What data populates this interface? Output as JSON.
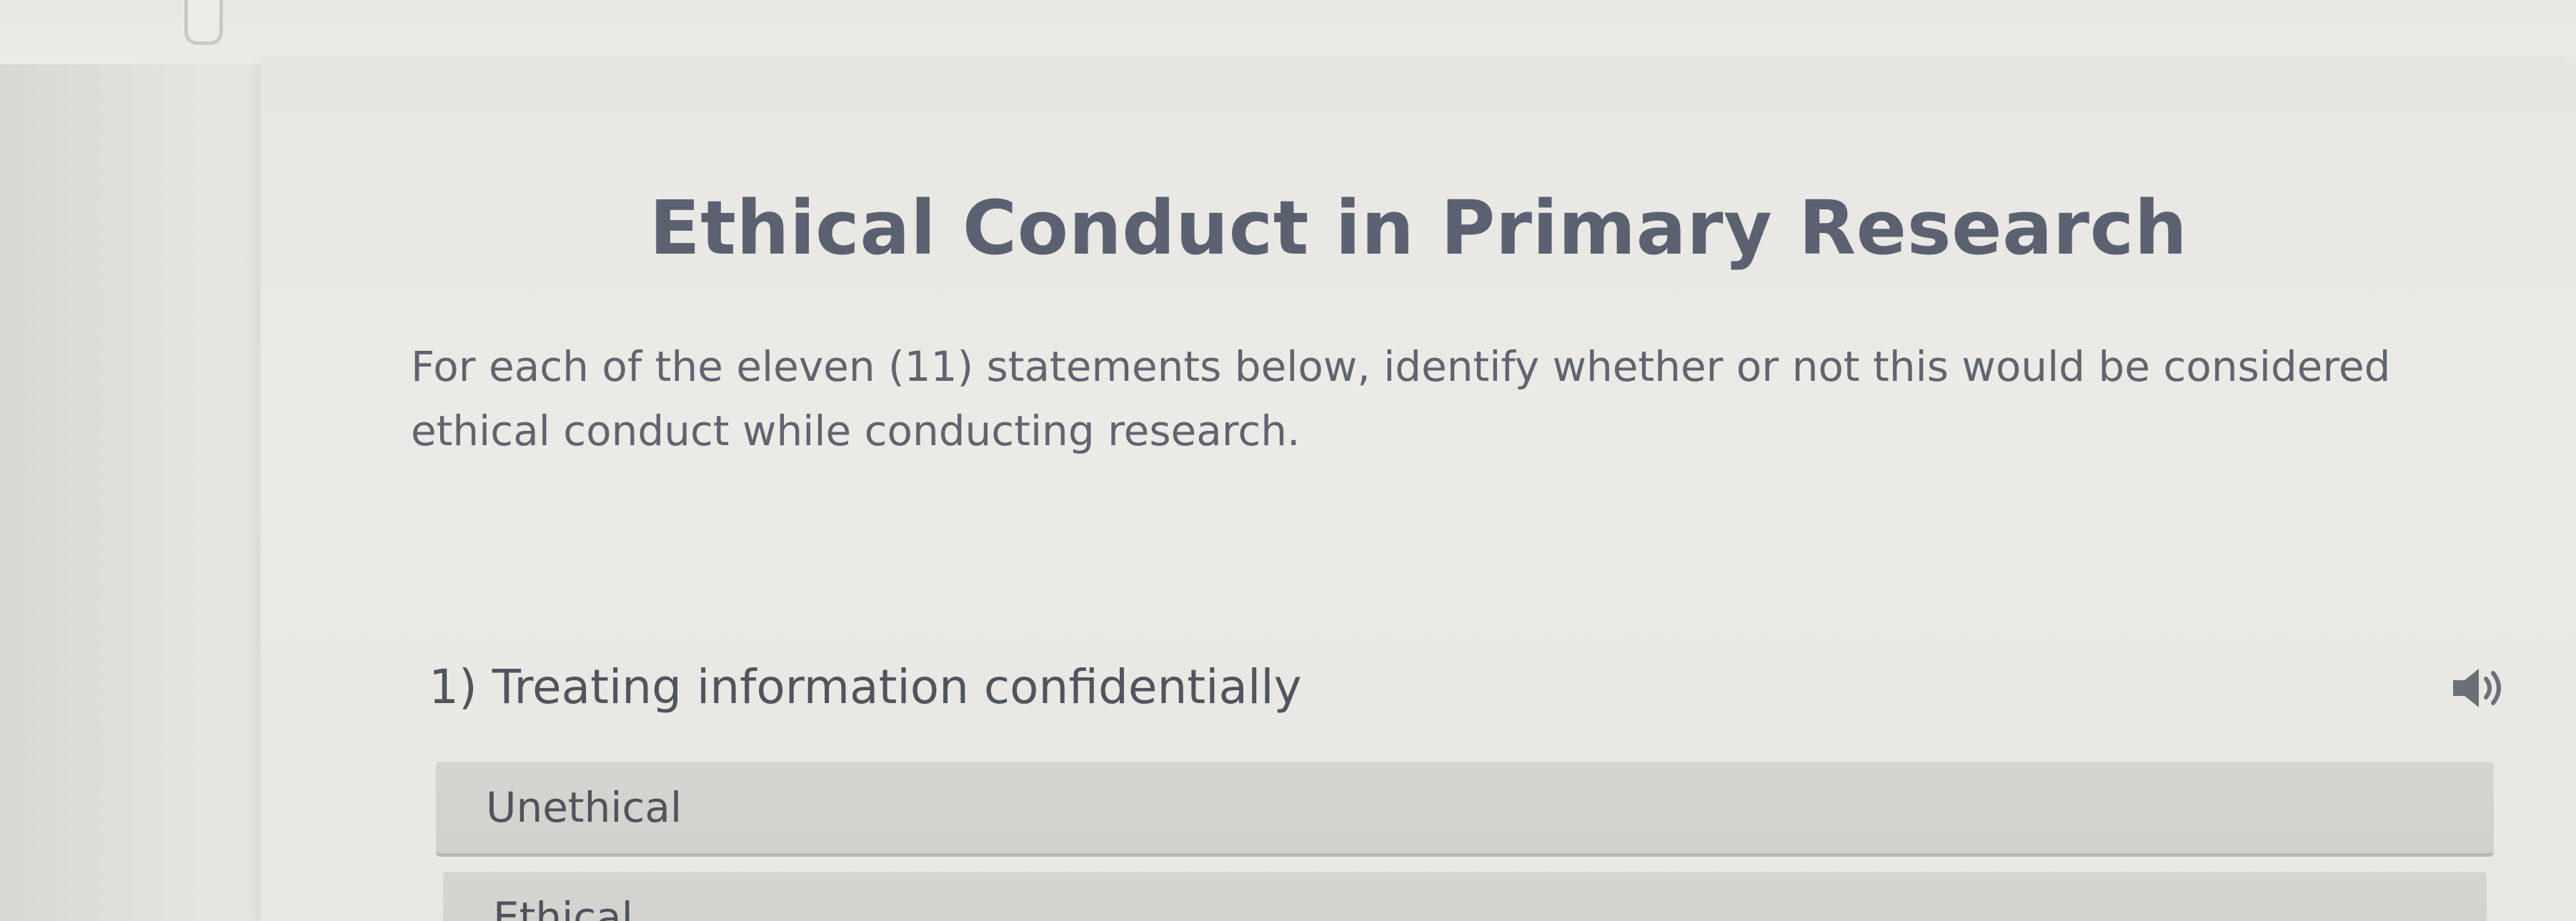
{
  "activity": {
    "title": "Ethical Conduct in Primary Research",
    "instructions": "For each of the eleven (11) statements below, identify whether or not this would be considered ethical conduct while conducting research."
  },
  "question": {
    "text": "1) Treating information confidentially",
    "audio_icon": "speaker-icon",
    "options": [
      {
        "label": "Unethical"
      },
      {
        "label": "Ethical"
      }
    ]
  }
}
